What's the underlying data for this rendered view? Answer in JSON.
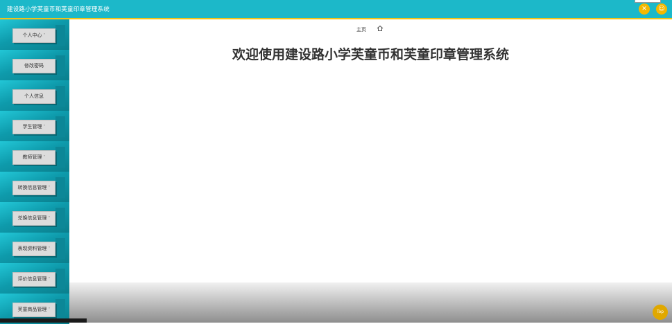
{
  "app": {
    "title": "建设路小学芙童币和芙童印章管理系统"
  },
  "header": {
    "icons": [
      "tools-icon",
      "user-icon"
    ],
    "accent": "#1cb8c9",
    "border": "#f2c318"
  },
  "sidebar": {
    "items": [
      {
        "label": "个人中心",
        "caret": "˅"
      },
      {
        "label": "修改密码",
        "caret": ""
      },
      {
        "label": "个人信息",
        "caret": ""
      },
      {
        "label": "学生管理",
        "caret": "˅"
      },
      {
        "label": "教师管理",
        "caret": "˅"
      },
      {
        "label": "转换信息管理",
        "caret": "˅"
      },
      {
        "label": "兑换信息管理",
        "caret": "˅"
      },
      {
        "label": "表现资料管理",
        "caret": "˅"
      },
      {
        "label": "评价信息管理",
        "caret": "˅"
      },
      {
        "label": "芙童商品管理",
        "caret": "˅"
      }
    ]
  },
  "main": {
    "breadcrumb": "主页",
    "welcome": "欢迎使用建设路小学芙童币和芙童印章管理系统",
    "top_button": "Top"
  }
}
